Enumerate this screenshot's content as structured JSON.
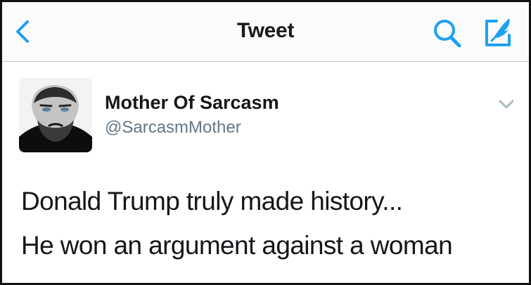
{
  "navbar": {
    "title": "Tweet",
    "back_icon": "chevron-left-icon",
    "search_icon": "search-icon",
    "compose_icon": "compose-tweet-icon",
    "accent_color": "#1da1f2"
  },
  "tweet": {
    "author": {
      "display_name": "Mother Of Sarcasm",
      "handle": "@SarcasmMother",
      "avatar": "profile-photo"
    },
    "menu_icon": "chevron-down-icon",
    "text_lines": [
      "Donald Trump truly made history...",
      "He won an argument against a woman"
    ]
  },
  "colors": {
    "text": "#14171a",
    "secondary_text": "#657786",
    "divider": "#c8ccd0",
    "border": "#111111"
  }
}
